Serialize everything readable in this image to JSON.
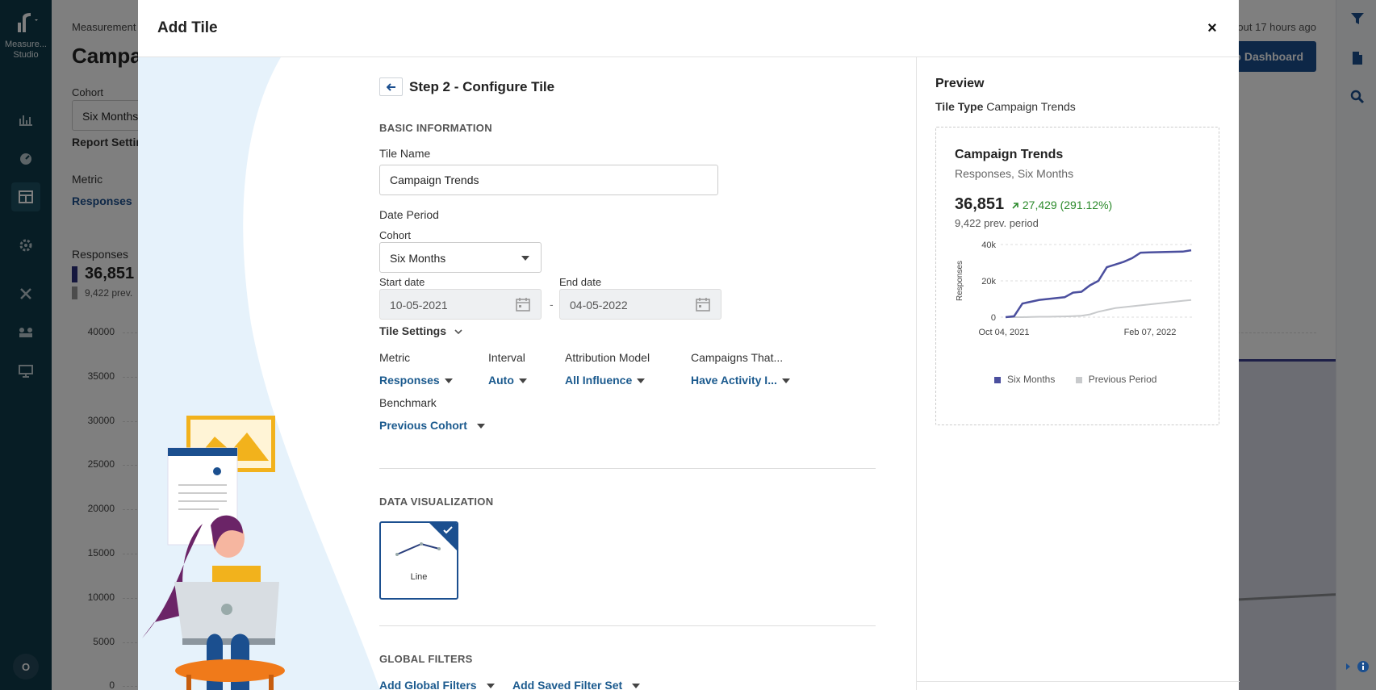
{
  "app": {
    "logo_text": "Measure... Studio",
    "avatar_initial": "O"
  },
  "background": {
    "breadcrumb": "Measurement",
    "title": "Campa",
    "updated": "out 17 hours ago",
    "dashboard_button": "to Dashboard",
    "cohort_label": "Cohort",
    "cohort_value": "Six Months",
    "report_settings": "Report Settin",
    "metric_label": "Metric",
    "metric_value": "Responses",
    "responses_label": "Responses",
    "responses_value": "36,851",
    "prev_value": "9,422 prev.",
    "y_ticks": [
      "40000",
      "35000",
      "30000",
      "25000",
      "20000",
      "15000",
      "10000",
      "5000",
      "0"
    ]
  },
  "modal": {
    "title": "Add Tile",
    "close_symbol": "×",
    "step_title": "Step 2 - Configure Tile",
    "basic_info": {
      "section_title": "BASIC INFORMATION",
      "tile_name_label": "Tile Name",
      "tile_name_value": "Campaign Trends",
      "date_period_label": "Date Period",
      "cohort_label": "Cohort",
      "cohort_value": "Six Months",
      "start_label": "Start date",
      "start_value": "10-05-2021",
      "end_label": "End date",
      "end_value": "04-05-2022",
      "dash": "-"
    },
    "tile_settings": {
      "label": "Tile Settings",
      "metric_label": "Metric",
      "metric_value": "Responses",
      "interval_label": "Interval",
      "interval_value": "Auto",
      "attribution_label": "Attribution Model",
      "attribution_value": "All Influence",
      "campaigns_label": "Campaigns That...",
      "campaigns_value": "Have Activity I...",
      "benchmark_label": "Benchmark",
      "benchmark_value": "Previous Cohort"
    },
    "data_viz": {
      "section_title": "DATA VISUALIZATION",
      "option_label": "Line"
    },
    "global_filters": {
      "section_title": "GLOBAL FILTERS",
      "add_filters": "Add Global Filters",
      "add_saved": "Add Saved Filter Set"
    }
  },
  "preview": {
    "title": "Preview",
    "tile_type_label": "Tile Type",
    "tile_type_value": "Campaign Trends",
    "card_title": "Campaign Trends",
    "card_subtitle": "Responses, Six Months",
    "value": "36,851",
    "change": "27,429 (291.12%)",
    "prev": "9,422 prev. period",
    "colors": {
      "series1": "#4b4f9e",
      "series2": "#c8cacc",
      "change": "#2c8a2c",
      "accent": "#1b4f8f"
    }
  },
  "chart_data": {
    "type": "line",
    "ylabel": "Responses",
    "ylim": [
      0,
      40000
    ],
    "y_ticks": [
      "40k",
      "20k",
      "0"
    ],
    "x_ticks": [
      "Oct 04, 2021",
      "Feb 07, 2022"
    ],
    "series": [
      {
        "name": "Six Months",
        "values": [
          0,
          500,
          7500,
          8500,
          9500,
          10000,
          10500,
          11000,
          13500,
          14000,
          17500,
          20000,
          27500,
          29000,
          30500,
          32500,
          35500,
          35700,
          35800,
          35900,
          36000,
          36100,
          36851
        ]
      },
      {
        "name": "Previous Period",
        "values": [
          0,
          0,
          0,
          100,
          200,
          200,
          300,
          400,
          600,
          800,
          1500,
          3000,
          4000,
          5000,
          5500,
          6000,
          6500,
          7000,
          7500,
          8000,
          8500,
          9000,
          9422
        ]
      }
    ],
    "legend_position": "bottom"
  }
}
